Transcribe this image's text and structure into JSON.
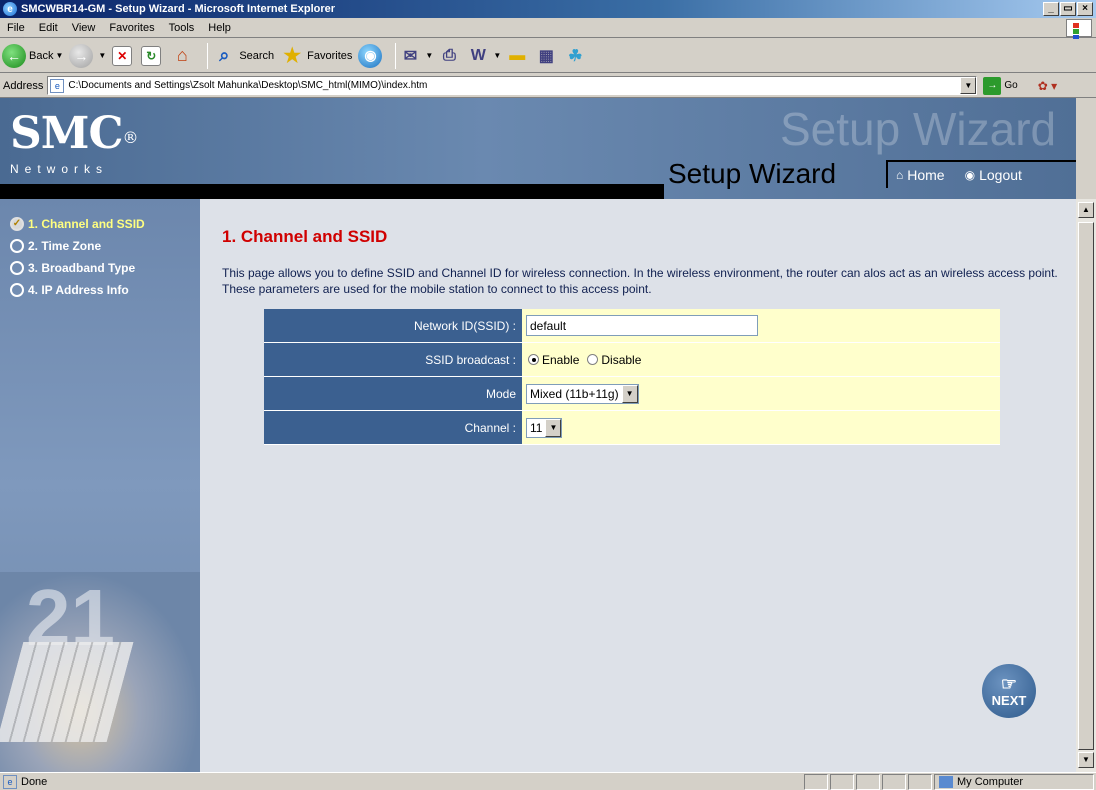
{
  "window": {
    "title": "SMCWBR14-GM - Setup Wizard - Microsoft Internet Explorer",
    "min": "_",
    "max": "▭",
    "close": "×"
  },
  "menu": [
    "File",
    "Edit",
    "View",
    "Favorites",
    "Tools",
    "Help"
  ],
  "toolbar": {
    "back": "Back",
    "search": "Search",
    "favorites": "Favorites"
  },
  "address": {
    "label": "Address",
    "value": "C:\\Documents and Settings\\Zsolt Mahunka\\Desktop\\SMC_html(MIMO)\\index.htm",
    "go": "Go"
  },
  "header": {
    "logo": "SMC",
    "logo_mark": "®",
    "logo_sub": "Networks",
    "ghost": "Setup Wizard",
    "title": "Setup Wizard",
    "home": "Home",
    "logout": "Logout"
  },
  "steps": [
    {
      "label": "1. Channel and SSID",
      "active": true
    },
    {
      "label": "2. Time Zone",
      "active": false
    },
    {
      "label": "3. Broadband Type",
      "active": false
    },
    {
      "label": "4. IP Address Info",
      "active": false
    }
  ],
  "sidebar_art": {
    "number": "21"
  },
  "content": {
    "title": "1. Channel and SSID",
    "description": "This page allows you to define SSID and Channel ID for wireless connection. In the wireless environment, the router can alos act as an wireless access point. These parameters are used for the mobile station to connect to this access point."
  },
  "form": {
    "ssid_label": "Network ID(SSID) :",
    "ssid_value": "default",
    "broadcast_label": "SSID broadcast :",
    "enable": "Enable",
    "disable": "Disable",
    "broadcast_selected": "Enable",
    "mode_label": "Mode",
    "mode_value": "Mixed (11b+11g)",
    "channel_label": "Channel :",
    "channel_value": "11"
  },
  "next": "NEXT",
  "status": {
    "left": "Done",
    "zone": "My Computer"
  }
}
